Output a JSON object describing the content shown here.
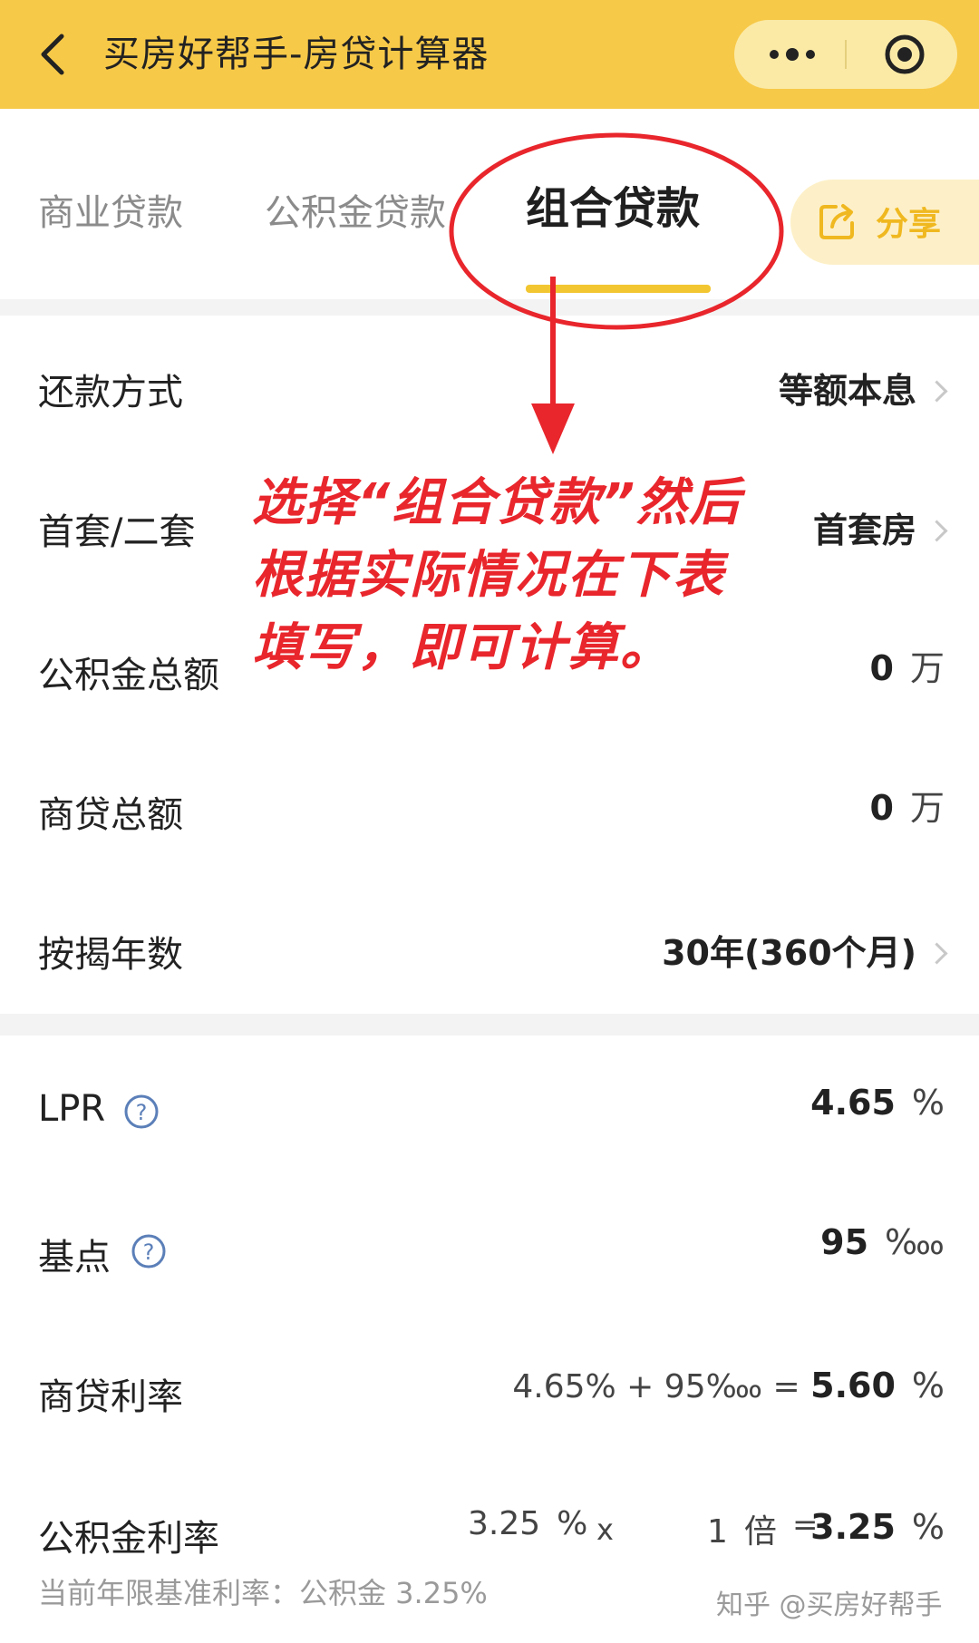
{
  "header": {
    "title": "买房好帮手-房贷计算器"
  },
  "tabs": [
    {
      "label": "商业贷款",
      "active": false
    },
    {
      "label": "公积金贷款",
      "active": false
    },
    {
      "label": "组合贷款",
      "active": true
    }
  ],
  "share": {
    "label": "分享"
  },
  "rows": {
    "repay_method": {
      "label": "还款方式",
      "value": "等额本息"
    },
    "house_type": {
      "label": "首套/二套",
      "value": "首套房"
    },
    "fund_total": {
      "label": "公积金总额",
      "value": "0",
      "unit": "万"
    },
    "commercial_total": {
      "label": "商贷总额",
      "value": "0",
      "unit": "万"
    },
    "years": {
      "label": "按揭年数",
      "value": "30年(360个月)"
    },
    "lpr": {
      "label": "LPR",
      "value": "4.65",
      "unit": "%"
    },
    "basis_points": {
      "label": "基点",
      "value": "95",
      "unit": "‱"
    },
    "commercial_rate": {
      "label": "商贷利率",
      "formula": "4.65% + 95‱ = ",
      "value": "5.60",
      "unit": "%"
    },
    "fund_rate": {
      "label": "公积金利率",
      "base": "3.25",
      "base_unit": "%",
      "times": "x",
      "multiplier": "1",
      "multiplier_unit": "倍",
      "equals": "=",
      "value": "3.25",
      "unit": "%",
      "note": "当前年限基准利率：公积金 3.25%"
    }
  },
  "annotation": {
    "text": "选择“组合贷款”然后根据实际情况在下表填写，即可计算。",
    "color": "#e8262c"
  },
  "watermark": "知乎 @买房好帮手",
  "colors": {
    "brand": "#f7c948",
    "accent": "#f2c630",
    "annotation": "#e8262c"
  }
}
